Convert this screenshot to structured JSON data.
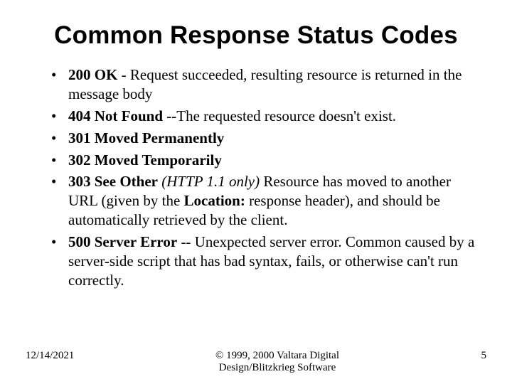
{
  "title": "Common Response Status Codes",
  "bullets": [
    {
      "code": "200 OK",
      "sep": " - ",
      "rest": "Request succeeded, resulting resource is returned in the message body"
    },
    {
      "code": "404 Not Found",
      "sep": " --",
      "rest": "The requested resource doesn't exist."
    },
    {
      "code": "301 Moved Permanently",
      "sep": "",
      "rest": ""
    },
    {
      "code": "302 Moved Temporarily",
      "sep": "",
      "rest": ""
    },
    {
      "code": "303 See Other",
      "note_italic": "(HTTP 1.1 only)",
      "rest2a": " Resource has moved to another URL (given by the ",
      "loc_bold": "Location:",
      "rest2b": " response header), and should be automatically retrieved by the client."
    },
    {
      "code": "500 Server Error",
      "sep": " -- ",
      "rest": "Unexpected server error. Common caused by a server-side script that has bad syntax, fails, or otherwise can't run correctly."
    }
  ],
  "footer": {
    "date": "12/14/2021",
    "copyright_line1": "© 1999, 2000 Valtara Digital",
    "copyright_line2": "Design/Blitzkrieg Software",
    "page": "5"
  }
}
